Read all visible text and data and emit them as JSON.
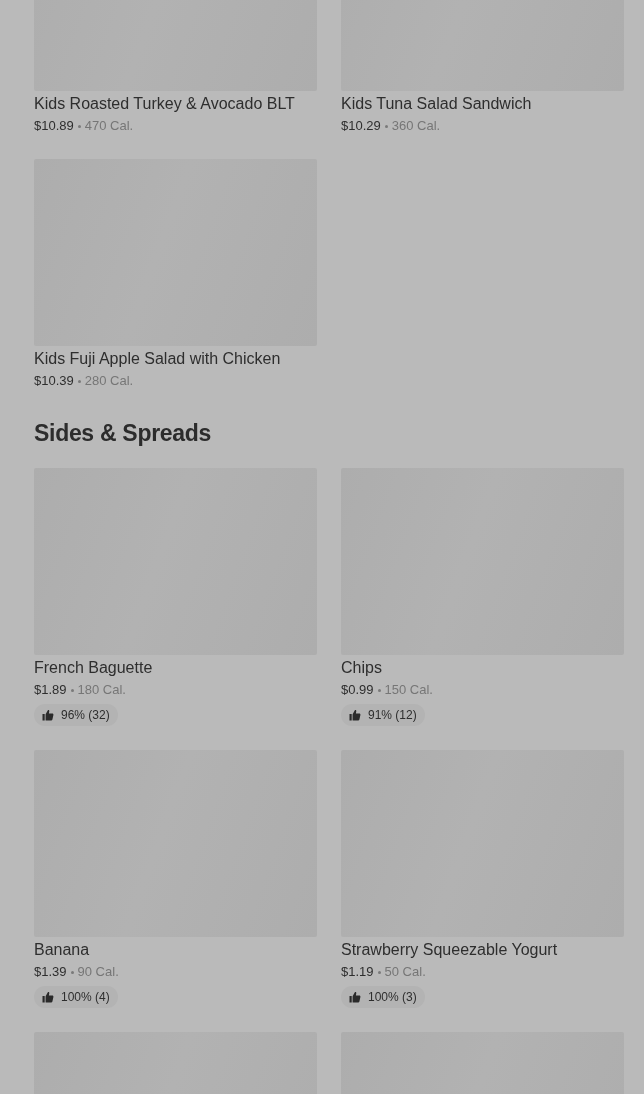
{
  "sections": [
    {
      "items": [
        {
          "kind": "item",
          "name": "Kids Roasted Turkey & Avocado BLT",
          "price": "$10.89",
          "calories": "470 Cal."
        },
        {
          "kind": "item",
          "name": "Kids Tuna Salad Sandwich",
          "price": "$10.29",
          "calories": "360 Cal."
        },
        {
          "kind": "item",
          "name": "Kids Fuji Apple Salad with Chicken",
          "price": "$10.39",
          "calories": "280 Cal."
        }
      ]
    },
    {
      "title": "Sides & Spreads",
      "items": [
        {
          "kind": "item",
          "name": "French Baguette",
          "price": "$1.89",
          "calories": "180 Cal.",
          "rating": "96% (32)"
        },
        {
          "kind": "item",
          "name": "Chips",
          "price": "$0.99",
          "calories": "150 Cal.",
          "rating": "91% (12)"
        },
        {
          "kind": "item",
          "name": "Banana",
          "price": "$1.39",
          "calories": "90 Cal.",
          "rating": "100% (4)"
        },
        {
          "kind": "item",
          "name": "Strawberry Squeezable Yogurt",
          "price": "$1.19",
          "calories": "50 Cal.",
          "rating": "100% (3)"
        },
        {
          "kind": "image_only"
        },
        {
          "kind": "image_only"
        }
      ]
    }
  ]
}
